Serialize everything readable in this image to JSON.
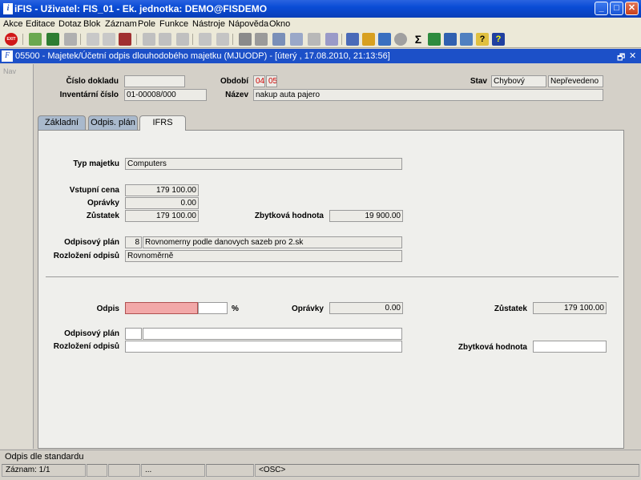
{
  "window": {
    "title": "iFIS - Uživatel: FIS_01 - Ek. jednotka: DEMO@FISDEMO",
    "minimize": "_",
    "maximize": "□",
    "close": "✕"
  },
  "menu": {
    "items": [
      "Akce",
      "Editace",
      "Dotaz",
      "Blok",
      "Záznam",
      "Pole",
      "Funkce",
      "Nástroje",
      "Nápověda",
      "Okno"
    ]
  },
  "toolbar": {
    "exit_label": "EXIT"
  },
  "inner_window": {
    "title": "05500 - Majetek/Účetní odpis dlouhodobého majetku (MJUODP) - [úterý , 17.08.2010, 21:13:56]",
    "restore": "🗗",
    "close": "✕"
  },
  "navigator": {
    "label": "Nav"
  },
  "header": {
    "cislo_dokladu_label": "Číslo dokladu",
    "cislo_dokladu": "",
    "obdobi_label": "Období",
    "obdobi_1": "04",
    "obdobi_2": "05",
    "stav_label": "Stav",
    "stav_1": "Chybový",
    "stav_2": "Nepřevedeno",
    "inventarni_cislo_label": "Inventární číslo",
    "inventarni_cislo": "01-00008/000",
    "nazev_label": "Název",
    "nazev": "nakup auta pajero"
  },
  "tabs": [
    {
      "label": "Základní",
      "active": false
    },
    {
      "label": "Odpis. plán",
      "active": false
    },
    {
      "label": "IFRS",
      "active": true
    }
  ],
  "ifrs": {
    "typ_majetku_label": "Typ majetku",
    "typ_majetku": "Computers",
    "vstupni_cena_label": "Vstupní cena",
    "vstupni_cena": "179 100.00",
    "opravky_label": "Oprávky",
    "opravky": "0.00",
    "zustatek_label": "Zůstatek",
    "zustatek": "179 100.00",
    "zbytkova_label": "Zbytková hodnota",
    "zbytkova": "19 900.00",
    "odpisovy_plan_label": "Odpisový plán",
    "odpisovy_plan_code": "8",
    "odpisovy_plan": "Rovnomerny podle danovych sazeb pro 2.sk",
    "rozlozeni_label": "Rozložení odpisů",
    "rozlozeni": "Rovnoměrně"
  },
  "lower": {
    "odpis_label": "Odpis",
    "odpis": "",
    "odpis_unit": "%",
    "opravky_label": "Oprávky",
    "opravky": "0.00",
    "zustatek_label": "Zůstatek",
    "zustatek": "179 100.00",
    "odpisovy_plan_label": "Odpisový plán",
    "odpisovy_plan_code": "",
    "odpisovy_plan": "",
    "rozlozeni_label": "Rozložení odpisů",
    "rozlozeni": "",
    "zbytkova_label": "Zbytková hodnota",
    "zbytkova": ""
  },
  "status": {
    "message": "Odpis dle standardu",
    "record": "Záznam: 1/1",
    "cell_dots": "...",
    "osc": "<OSC>"
  }
}
